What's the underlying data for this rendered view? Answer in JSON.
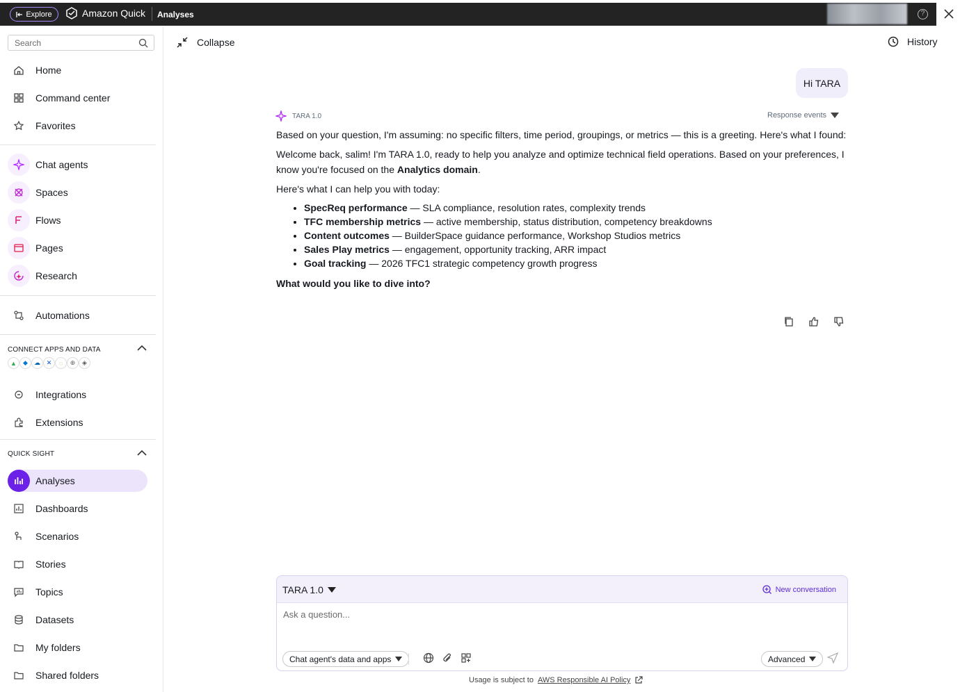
{
  "topbar": {
    "explore_label": "Explore",
    "app_name": "Amazon Quick",
    "breadcrumb": "Analyses"
  },
  "sidebar": {
    "search_placeholder": "Search",
    "primary": [
      {
        "label": "Home",
        "icon": "home-icon"
      },
      {
        "label": "Command center",
        "icon": "grid-icon"
      },
      {
        "label": "Favorites",
        "icon": "star-icon"
      }
    ],
    "agents": [
      {
        "label": "Chat agents",
        "icon": "sparkle-icon"
      },
      {
        "label": "Spaces",
        "icon": "spaces-icon"
      },
      {
        "label": "Flows",
        "icon": "flows-icon"
      },
      {
        "label": "Pages",
        "icon": "pages-icon"
      },
      {
        "label": "Research",
        "icon": "research-icon"
      }
    ],
    "automations_label": "Automations",
    "connect_section": "CONNECT APPS AND DATA",
    "connect_items": [
      {
        "label": "Integrations",
        "icon": "integrations-icon"
      },
      {
        "label": "Extensions",
        "icon": "extensions-icon"
      }
    ],
    "quicksight_section": "QUICK SIGHT",
    "quicksight_items": [
      {
        "label": "Analyses",
        "icon": "analyses-icon",
        "active": true
      },
      {
        "label": "Dashboards",
        "icon": "dashboards-icon"
      },
      {
        "label": "Scenarios",
        "icon": "scenarios-icon"
      },
      {
        "label": "Stories",
        "icon": "stories-icon"
      },
      {
        "label": "Topics",
        "icon": "topics-icon"
      },
      {
        "label": "Datasets",
        "icon": "datasets-icon"
      },
      {
        "label": "My folders",
        "icon": "folder-icon"
      },
      {
        "label": "Shared folders",
        "icon": "shared-folder-icon"
      }
    ]
  },
  "main": {
    "collapse_label": "Collapse",
    "history_label": "History",
    "user_message": "Hi TARA",
    "bot_name": "TARA 1.0",
    "response_events_label": "Response events",
    "bot_intro": "Based on your question, I'm assuming: no specific filters, time period, groupings, or metrics — this is a greeting. Here's what I found:",
    "welcome_pre": "Welcome back, salim! I'm TARA 1.0, ready to help you analyze and optimize technical field operations. Based on your preferences, I know you're focused on the ",
    "welcome_bold": "Analytics domain",
    "welcome_post": ".",
    "help_intro": "Here's what I can help you with today:",
    "bullets": [
      {
        "title": "SpecReq performance",
        "desc": " — SLA compliance, resolution rates, complexity trends"
      },
      {
        "title": "TFC membership metrics",
        "desc": " — active membership, status distribution, competency breakdowns"
      },
      {
        "title": "Content outcomes",
        "desc": " — BuilderSpace guidance performance, Workshop Studios metrics"
      },
      {
        "title": "Sales Play metrics",
        "desc": " — engagement, opportunity tracking, ARR impact"
      },
      {
        "title": "Goal tracking",
        "desc": " — 2026 TFC1 strategic competency growth progress"
      }
    ],
    "closing_question": "What would you like to dive into?"
  },
  "composer": {
    "agent_label": "TARA 1.0",
    "new_conversation_label": "New conversation",
    "placeholder": "Ask a question...",
    "source_pill": "Chat agent's data and apps",
    "advanced_pill": "Advanced"
  },
  "footer": {
    "note": "Usage is subject to",
    "link": "AWS Responsible AI Policy"
  }
}
